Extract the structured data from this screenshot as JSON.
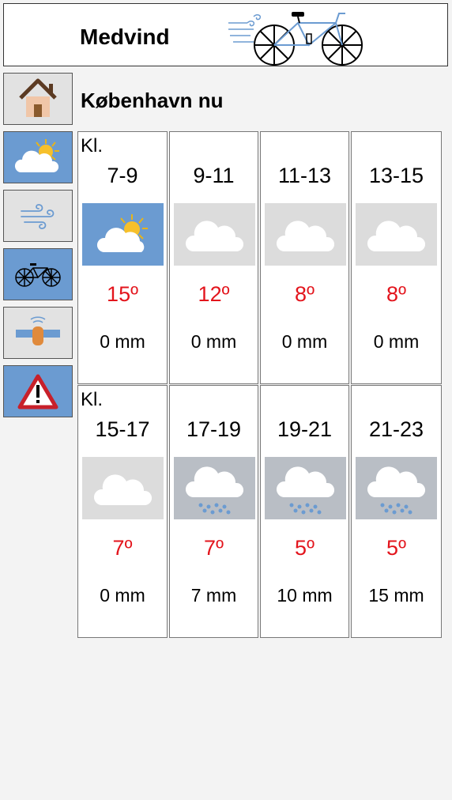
{
  "app": {
    "title": "Medvind",
    "logo_icon": "bicycle-with-wind-icon"
  },
  "sidebar": {
    "items": [
      {
        "name": "home",
        "icon": "house-icon",
        "active": false
      },
      {
        "name": "weather",
        "icon": "sun-cloud-icon",
        "active": true
      },
      {
        "name": "wind",
        "icon": "wind-icon",
        "active": false
      },
      {
        "name": "bike",
        "icon": "bicycle-icon",
        "active": true
      },
      {
        "name": "satellite",
        "icon": "satellite-icon",
        "active": false
      },
      {
        "name": "warning",
        "icon": "warning-icon",
        "active": true
      }
    ]
  },
  "location": {
    "title": "København nu"
  },
  "forecast": {
    "time_prefix": "Kl.",
    "rows": [
      [
        {
          "time": "7-9",
          "icon": "sun-cloud-icon",
          "temp": "15º",
          "precip": "0 mm"
        },
        {
          "time": "9-11",
          "icon": "cloud-icon",
          "temp": "12º",
          "precip": "0 mm"
        },
        {
          "time": "11-13",
          "icon": "cloud-icon",
          "temp": "8º",
          "precip": "0 mm"
        },
        {
          "time": "13-15",
          "icon": "cloud-icon",
          "temp": "8º",
          "precip": "0 mm"
        }
      ],
      [
        {
          "time": "15-17",
          "icon": "cloud-icon",
          "temp": "7º",
          "precip": "0 mm"
        },
        {
          "time": "17-19",
          "icon": "rain-cloud-icon",
          "temp": "7º",
          "precip": "7 mm"
        },
        {
          "time": "19-21",
          "icon": "rain-cloud-icon",
          "temp": "5º",
          "precip": "10 mm"
        },
        {
          "time": "21-23",
          "icon": "rain-cloud-icon",
          "temp": "5º",
          "precip": "15 mm"
        }
      ]
    ]
  },
  "colors": {
    "active_button": "#6b9bd1",
    "inactive_button": "#e2e2e2",
    "temperature_text": "#e3141c",
    "cloudy_background": "#dcdcdc",
    "rain_background": "#b9bec5"
  }
}
